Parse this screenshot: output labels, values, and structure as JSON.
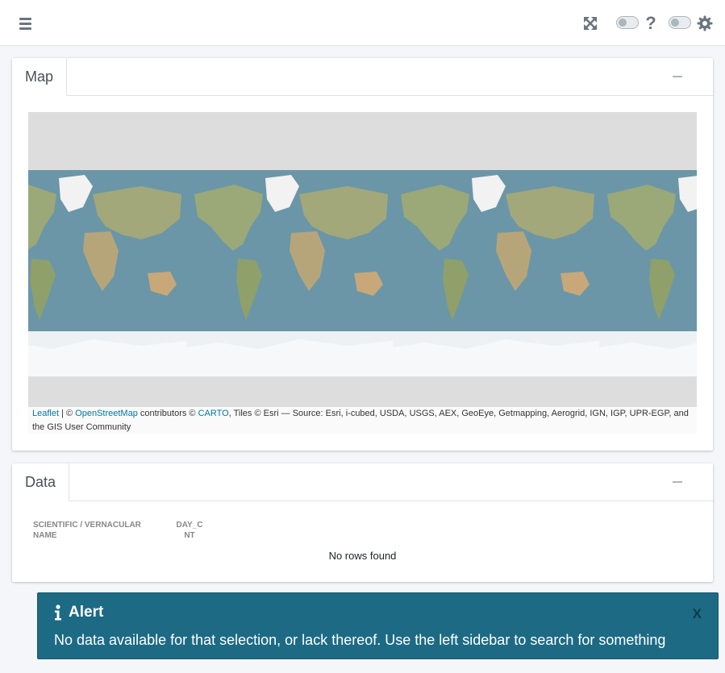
{
  "navbar": {
    "menu_icon": "hamburger-icon",
    "expand_icon": "expand-arrows-icon",
    "help_label": "?",
    "settings_icon": "gear-icon"
  },
  "map_card": {
    "title": "Map",
    "attribution": {
      "leaflet": "Leaflet",
      "sep1": " | © ",
      "osm": "OpenStreetMap",
      "mid": " contributors © ",
      "carto": "CARTO",
      "rest": ", Tiles © Esri — Source: Esri, i-cubed, USDA, USGS, AEX, GeoEye, Getmapping, Aerogrid, IGN, IGP, UPR-EGP, and the GIS User Community"
    }
  },
  "data_card": {
    "title": "Data",
    "columns": [
      "SCIENTIFIC / VERNACULAR NAME",
      "DAY_C NT"
    ],
    "empty_message": "No rows found"
  },
  "alert": {
    "title": "Alert",
    "close_label": "X",
    "message": "No data available for that selection, or lack thereof. Use the left sidebar to search for something"
  },
  "colors": {
    "alert_bg": "#1d6a84",
    "link": "#0078a8",
    "ocean": "#6b96a8",
    "ice": "#eef1f3"
  }
}
